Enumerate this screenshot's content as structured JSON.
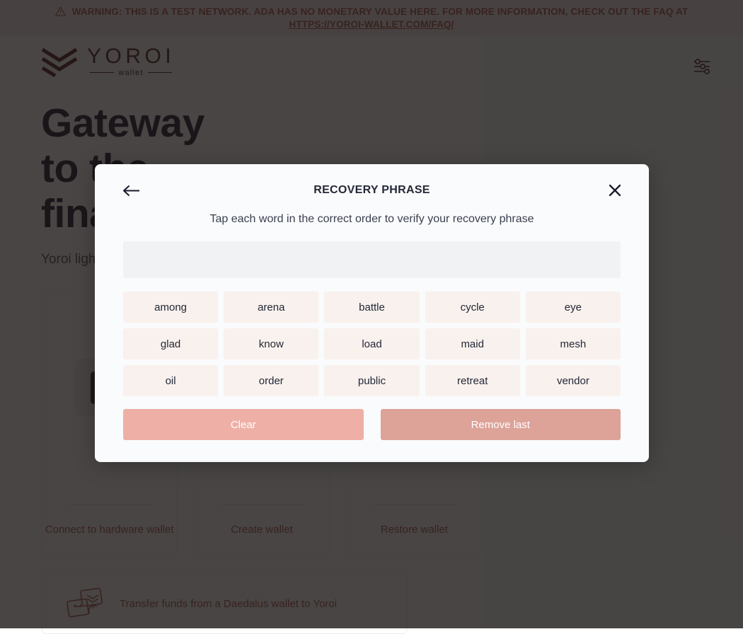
{
  "banner": {
    "icon": "warning-triangle-icon",
    "line1": "WARNING: THIS IS A TEST NETWORK. ADA HAS NO MONETARY VALUE HERE. FOR MORE INFORMATION, CHECK OUT THE FAQ AT",
    "link": "HTTPS://YOROI-WALLET.COM/FAQ/",
    "text_color": "#ad4f48",
    "bg_color": "#fbeeed"
  },
  "header": {
    "logo_word": "YOROI",
    "logo_sub": "wallet",
    "settings_icon": "sliders-settings-icon"
  },
  "hero": {
    "title": "Gateway\nto the\nfinancial world",
    "subtitle": "Yoroi light wallet for Cardano blockchain"
  },
  "cards": [
    {
      "icon": "hardware-wallet-icon",
      "label": "Connect to hardware wallet"
    },
    {
      "icon": "create-wallet-icon",
      "label": "Create wallet"
    },
    {
      "icon": "restore-wallet-icon",
      "label": "Restore wallet"
    }
  ],
  "transfer": {
    "icon": "daedalus-transfer-icon",
    "label": "Transfer funds from a Daedalus wallet to Yoroi"
  },
  "modal": {
    "back_icon": "arrow-left-icon",
    "title": "RECOVERY PHRASE",
    "close_icon": "close-x-icon",
    "instruction": "Tap each word in the correct order to verify your recovery phrase",
    "selected_words": [],
    "words": [
      "among",
      "arena",
      "battle",
      "cycle",
      "eye",
      "glad",
      "know",
      "load",
      "maid",
      "mesh",
      "oil",
      "order",
      "public",
      "retreat",
      "vendor"
    ],
    "clear_label": "Clear",
    "remove_last_label": "Remove last",
    "clear_color": "#eeb0a6",
    "remove_last_color": "#dda298",
    "chip_color": "#f8f1ed",
    "phrase_box_color": "#f1f2f4"
  }
}
